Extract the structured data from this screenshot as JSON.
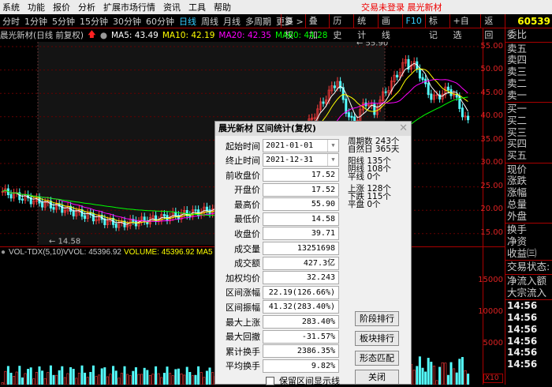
{
  "menu": {
    "items": [
      "系统",
      "功能",
      "报价",
      "分析",
      "扩展市场行情",
      "资讯",
      "工具",
      "帮助"
    ],
    "login_status": "交易未登录 晨光新材"
  },
  "toolbar": {
    "periods": [
      "分时",
      "1分钟",
      "5分钟",
      "15分钟",
      "30分钟",
      "60分钟",
      "日线",
      "周线",
      "月线",
      "多周期",
      "更多 >"
    ],
    "active": "日线",
    "buttons": [
      "复权",
      "叠加",
      "历史",
      "统计",
      "画线",
      "F10",
      "标记",
      "+自选",
      "返回"
    ]
  },
  "chart_title": {
    "name": "晨光新材(日线 前复权)",
    "ma5": "MA5: 43.49",
    "ma10": "MA10: 42.19",
    "ma20": "MA20: 42.35",
    "ma60": "MA60: 44.28",
    "high_label": "55.90",
    "low_label": "14.58"
  },
  "price_axis": [
    "55.00",
    "50.00",
    "45.00",
    "40.00",
    "35.00",
    "30.00",
    "25.00",
    "20.00",
    "15.00"
  ],
  "volume": {
    "header": "VOL-TDX(5,10)",
    "vvol": "VVOL: 45396.92",
    "volume": "VOLUME: 45396.92",
    "ma5": "MA5",
    "axis": [
      "15000",
      "10000",
      "5000"
    ],
    "unit": "X10"
  },
  "colors": {
    "ma5": "#ffffff",
    "ma10": "#ffff00",
    "ma20": "#ff00ff",
    "ma60": "#00ff00",
    "up": "#ff3c3c",
    "down": "#54ffff"
  },
  "right_panel": {
    "code": "60539",
    "rows": {
      "ratio": [
        "委比"
      ],
      "sell": [
        "卖五",
        "卖四",
        "卖三",
        "卖二",
        "卖一"
      ],
      "buy": [
        "买一",
        "买二",
        "买三",
        "买四",
        "买五"
      ],
      "quote": [
        "现价",
        "涨跌",
        "涨幅",
        "总量",
        "外盘"
      ],
      "fund": [
        "换手",
        "净资",
        "收益㈢"
      ],
      "state": [
        "交易状态:"
      ],
      "flow": [
        "净流入额",
        "大宗流入"
      ],
      "times": [
        "14:56",
        "14:56",
        "14:56",
        "14:56",
        "14:56",
        "14:56"
      ]
    }
  },
  "dialog": {
    "title": "晨光新材 区间统计(复权)",
    "start_label": "起始时间",
    "start": "2021-01-01",
    "end_label": "终止时间",
    "end": "2021-12-31",
    "fields": [
      {
        "label": "前收盘价",
        "value": "17.52"
      },
      {
        "label": "开盘价",
        "value": "17.52"
      },
      {
        "label": "最高价",
        "value": "55.90"
      },
      {
        "label": "最低价",
        "value": "14.58"
      },
      {
        "label": "收盘价",
        "value": "39.71"
      },
      {
        "label": "成交量",
        "value": "13251698"
      },
      {
        "label": "成交额",
        "value": "427.3亿"
      },
      {
        "label": "加权均价",
        "value": "32.243"
      },
      {
        "label": "区间涨幅",
        "value": "22.19(126.66%)"
      },
      {
        "label": "区间振幅",
        "value": "41.32(283.40%)"
      },
      {
        "label": "最大上涨",
        "value": "283.40%"
      },
      {
        "label": "最大回撤",
        "value": "-31.57%"
      },
      {
        "label": "累计换手",
        "value": "2386.35%"
      },
      {
        "label": "平均换手",
        "value": "9.82%"
      }
    ],
    "stats": [
      [
        "周期数",
        "243个"
      ],
      [
        "自然日",
        "365天"
      ],
      [
        "阳线",
        "135个"
      ],
      [
        "阴线",
        "108个"
      ],
      [
        "平线",
        "0个"
      ],
      [
        "上涨",
        "128个"
      ],
      [
        "下跌",
        "115个"
      ],
      [
        "平盘",
        "0个"
      ]
    ],
    "buttons": [
      "阶段排行",
      "板块排行",
      "形态匹配",
      "关闭"
    ],
    "keep_lines": "保留区间显示线"
  }
}
